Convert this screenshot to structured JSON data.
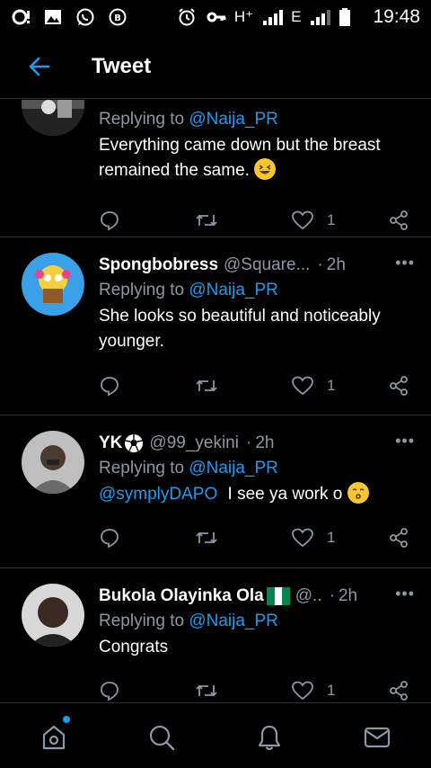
{
  "status_bar": {
    "network": "H⁺",
    "network2": "E",
    "time": "19:48"
  },
  "header": {
    "title": "Tweet"
  },
  "tweets": [
    {
      "replying_label": "Replying to",
      "replying_to": "@Naija_PR",
      "text": "Everything came down but the breast remained the same.",
      "likes": "1"
    },
    {
      "name": "Spongbobress",
      "handle": "@Square...",
      "separator": "·",
      "time": "2h",
      "more": "•••",
      "replying_label": "Replying to",
      "replying_to": "@Naija_PR",
      "text": "She looks so beautiful and noticeably younger.",
      "likes": "1"
    },
    {
      "name": "YK",
      "handle": "@99_yekini",
      "separator": "·",
      "time": "2h",
      "more": "•••",
      "replying_label": "Replying to",
      "replying_to": "@Naija_PR",
      "mention": "@symplyDAPO",
      "text": "I see ya work o",
      "likes": "1"
    },
    {
      "name": "Bukola Olayinka Ola",
      "handle": "@..",
      "separator": "·",
      "time": "2h",
      "more": "•••",
      "replying_label": "Replying to",
      "replying_to": "@Naija_PR",
      "text": "Congrats",
      "likes": "1"
    }
  ],
  "bottom_nav": [
    "home-icon",
    "search-icon",
    "notifications-icon",
    "messages-icon"
  ],
  "colors": {
    "accent": "#1d9bf0",
    "muted": "#8b98a5",
    "divider": "#2f3336",
    "background": "#000000"
  }
}
